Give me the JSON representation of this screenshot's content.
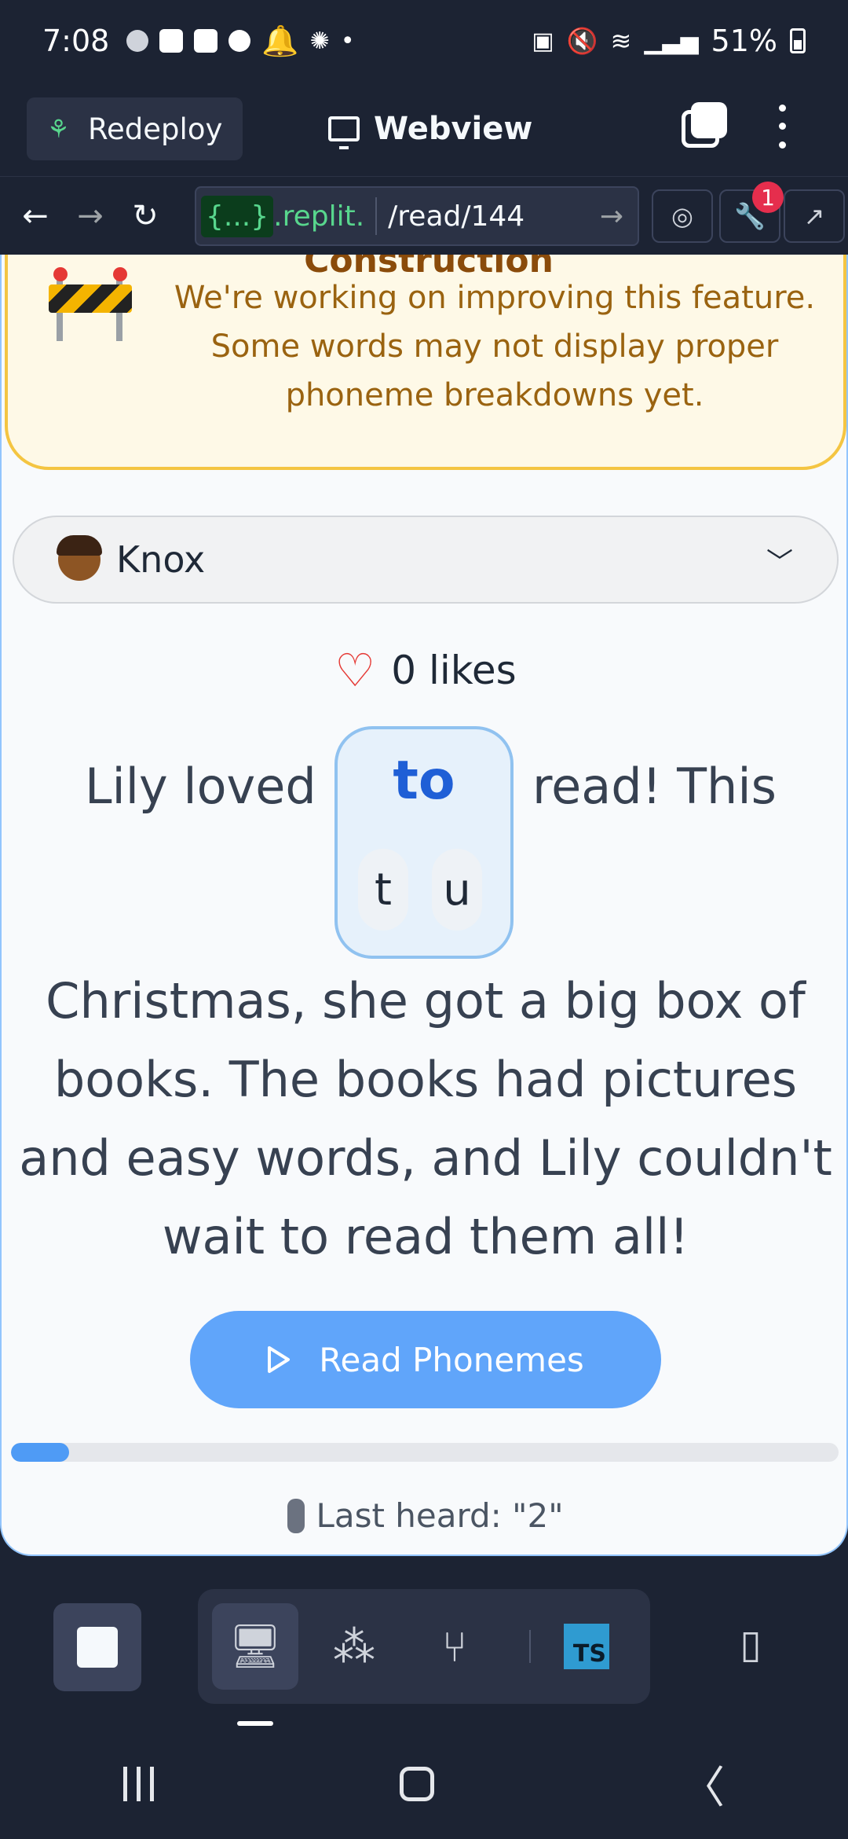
{
  "status_bar": {
    "time": "7:08",
    "battery": "51%"
  },
  "header": {
    "redeploy_label": "Redeploy",
    "title": "Webview"
  },
  "browser": {
    "host": "{...}",
    "host_suffix": ".replit.",
    "path": "/read/144",
    "badge_count": "1"
  },
  "banner": {
    "title": "Construction",
    "text": "We're working on improving this feature. Some words may not display proper phoneme breakdowns yet."
  },
  "reader_select": {
    "selected": "Knox"
  },
  "likes": {
    "label": "0 likes"
  },
  "story": {
    "line1_before": "Lily loved",
    "highlight_word": "to",
    "phonemes": [
      "t",
      "u"
    ],
    "line1_after": "read! This",
    "paragraph": "Christmas, she got a big box of books. The books had pictures and easy words, and Lily couldn't wait to read them all!"
  },
  "controls": {
    "read_button_label": "Read Phonemes",
    "progress_percent": 7
  },
  "last_heard": {
    "label": "Last heard: \"2\""
  },
  "toolbar": {
    "ts_label": "TS"
  },
  "colors": {
    "accent": "#60a5fa",
    "banner_bg": "#fef9e7",
    "banner_border": "#f4c542",
    "app_bg": "#1c2333"
  }
}
